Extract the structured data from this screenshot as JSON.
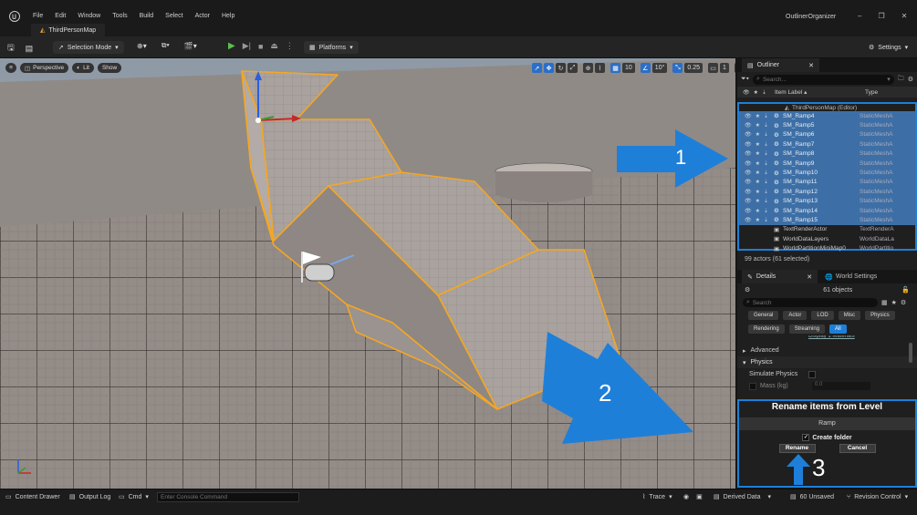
{
  "menu": [
    "File",
    "Edit",
    "Window",
    "Tools",
    "Build",
    "Select",
    "Actor",
    "Help"
  ],
  "app_title": "OutlinerOrganizer",
  "map_tab": "ThirdPersonMap",
  "toolbar": {
    "selection_mode": "Selection Mode",
    "platforms": "Platforms",
    "settings": "Settings"
  },
  "viewport": {
    "perspective": "Perspective",
    "lit": "Lit",
    "show": "Show",
    "grid_size": "10",
    "rotation_snap": "10°",
    "scale_snap": "0.25",
    "camera_speed": "1"
  },
  "annotations": {
    "arrow1": "1",
    "arrow2": "2",
    "arrow3": "3"
  },
  "outliner": {
    "tab": "Outliner",
    "search_placeholder": "Search...",
    "col_label": "Item Label ▴",
    "col_type": "Type",
    "root": "ThirdPersonMap (Editor)",
    "rows": [
      {
        "name": "SM_Ramp4",
        "type": "StaticMeshA",
        "sel": true
      },
      {
        "name": "SM_Ramp5",
        "type": "StaticMeshA",
        "sel": true
      },
      {
        "name": "SM_Ramp6",
        "type": "StaticMeshA",
        "sel": true
      },
      {
        "name": "SM_Ramp7",
        "type": "StaticMeshA",
        "sel": true
      },
      {
        "name": "SM_Ramp8",
        "type": "StaticMeshA",
        "sel": true
      },
      {
        "name": "SM_Ramp9",
        "type": "StaticMeshA",
        "sel": true
      },
      {
        "name": "SM_Ramp10",
        "type": "StaticMeshA",
        "sel": true
      },
      {
        "name": "SM_Ramp11",
        "type": "StaticMeshA",
        "sel": true
      },
      {
        "name": "SM_Ramp12",
        "type": "StaticMeshA",
        "sel": true
      },
      {
        "name": "SM_Ramp13",
        "type": "StaticMeshA",
        "sel": true
      },
      {
        "name": "SM_Ramp14",
        "type": "StaticMeshA",
        "sel": true
      },
      {
        "name": "SM_Ramp15",
        "type": "StaticMeshA",
        "sel": true
      },
      {
        "name": "TextRenderActor",
        "type": "TextRenderA",
        "sel": false
      },
      {
        "name": "WorldDataLayers",
        "type": "WorldDataLa",
        "sel": false
      },
      {
        "name": "WorldPartitionMiniMap0",
        "type": "WorldPartitio",
        "sel": false
      }
    ],
    "count": "99 actors (61 selected)"
  },
  "details": {
    "tab": "Details",
    "world_tab": "World Settings",
    "objects": "61 objects",
    "search_placeholder": "Search",
    "categories": [
      "General",
      "Actor",
      "LOD",
      "Misc",
      "Physics",
      "Rendering",
      "Streaming",
      "All"
    ],
    "cut_text": "Display 1 Materials",
    "advanced": "Advanced",
    "physics": "Physics",
    "simulate_physics": "Simulate Physics",
    "mass": "Mass (kg)",
    "mass_value": "0.0"
  },
  "rename": {
    "title": "Rename items from Level",
    "input_value": "Ramp",
    "create_folder": "Create folder",
    "rename_btn": "Rename",
    "cancel_btn": "Cancel"
  },
  "status": {
    "content_drawer": "Content Drawer",
    "output_log": "Output Log",
    "cmd": "Cmd",
    "console_placeholder": "Enter Console Command",
    "trace": "Trace",
    "derived_data": "Derived Data",
    "unsaved": "60 Unsaved",
    "revision_control": "Revision Control"
  },
  "colors": {
    "accent": "#1e7fd9",
    "selection": "#3d6fa6",
    "mesh_outline": "#f5a623",
    "play": "#5bbf4c"
  }
}
